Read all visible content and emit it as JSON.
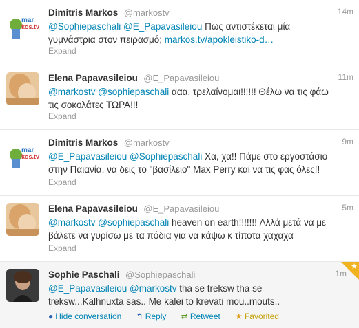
{
  "colors": {
    "link": "#0084b4",
    "muted": "#999999",
    "favorited": "#f1b21f"
  },
  "tweets": [
    {
      "fullname": "Dimitris Markos",
      "username": "@markostv",
      "time": "14m",
      "avatar": "markostv-logo",
      "parts": [
        {
          "t": "@Sophiepaschali",
          "k": "mention"
        },
        {
          "t": " ",
          "k": "text"
        },
        {
          "t": "@E_Papavasileiou",
          "k": "mention"
        },
        {
          "t": " Πως αντιστέκεται μία γυμνάστρια στον πειρασμό; ",
          "k": "text"
        },
        {
          "t": "markos.tv/apokleistiko-d…",
          "k": "link"
        }
      ],
      "expand": "Expand"
    },
    {
      "fullname": "Elena Papavasileiou",
      "username": "@E_Papavasileiou",
      "time": "11m",
      "avatar": "elena-photo",
      "parts": [
        {
          "t": "@markostv",
          "k": "mention"
        },
        {
          "t": " ",
          "k": "text"
        },
        {
          "t": "@sophiepaschali",
          "k": "mention"
        },
        {
          "t": " ααα, τρελαίνομαι!!!!!! Θέλω να τις φάω τις σοκολάτες ΤΩΡΑ!!!",
          "k": "text"
        }
      ],
      "expand": "Expand"
    },
    {
      "fullname": "Dimitris Markos",
      "username": "@markostv",
      "time": "9m",
      "avatar": "markostv-logo",
      "parts": [
        {
          "t": "@E_Papavasileiou",
          "k": "mention"
        },
        {
          "t": " ",
          "k": "text"
        },
        {
          "t": "@Sophiepaschali",
          "k": "mention"
        },
        {
          "t": " Χα, χα!! Πάμε στο εργοστάσιο στην Παιανία, να δεις το \"βασίλειο\" Max Perry και να τις φας όλες!!",
          "k": "text"
        }
      ],
      "expand": "Expand"
    },
    {
      "fullname": "Elena Papavasileiou",
      "username": "@E_Papavasileiou",
      "time": "5m",
      "avatar": "elena-photo",
      "parts": [
        {
          "t": "@markostv",
          "k": "mention"
        },
        {
          "t": " ",
          "k": "text"
        },
        {
          "t": "@sophiepaschali",
          "k": "mention"
        },
        {
          "t": " heaven on earth!!!!!!! Αλλά μετά να με βάλετε να γυρίσω με τα πόδια για να κάψω κ τίποτα χαχαχα",
          "k": "text"
        }
      ],
      "expand": "Expand"
    },
    {
      "fullname": "Sophie Paschali",
      "username": "@Sophiepaschali",
      "time": "1m",
      "avatar": "sophie-photo",
      "favorited": true,
      "parts": [
        {
          "t": "@E_Papavasileiou",
          "k": "mention"
        },
        {
          "t": " ",
          "k": "text"
        },
        {
          "t": "@markostv",
          "k": "mention"
        },
        {
          "t": " tha se treksw tha se treksw...Kalhnuxta sas.. Me kalei to krevati mou..mouts..",
          "k": "text"
        }
      ],
      "actions": {
        "hide": "Hide conversation",
        "reply": "Reply",
        "retweet": "Retweet",
        "favorited": "Favorited"
      }
    }
  ]
}
